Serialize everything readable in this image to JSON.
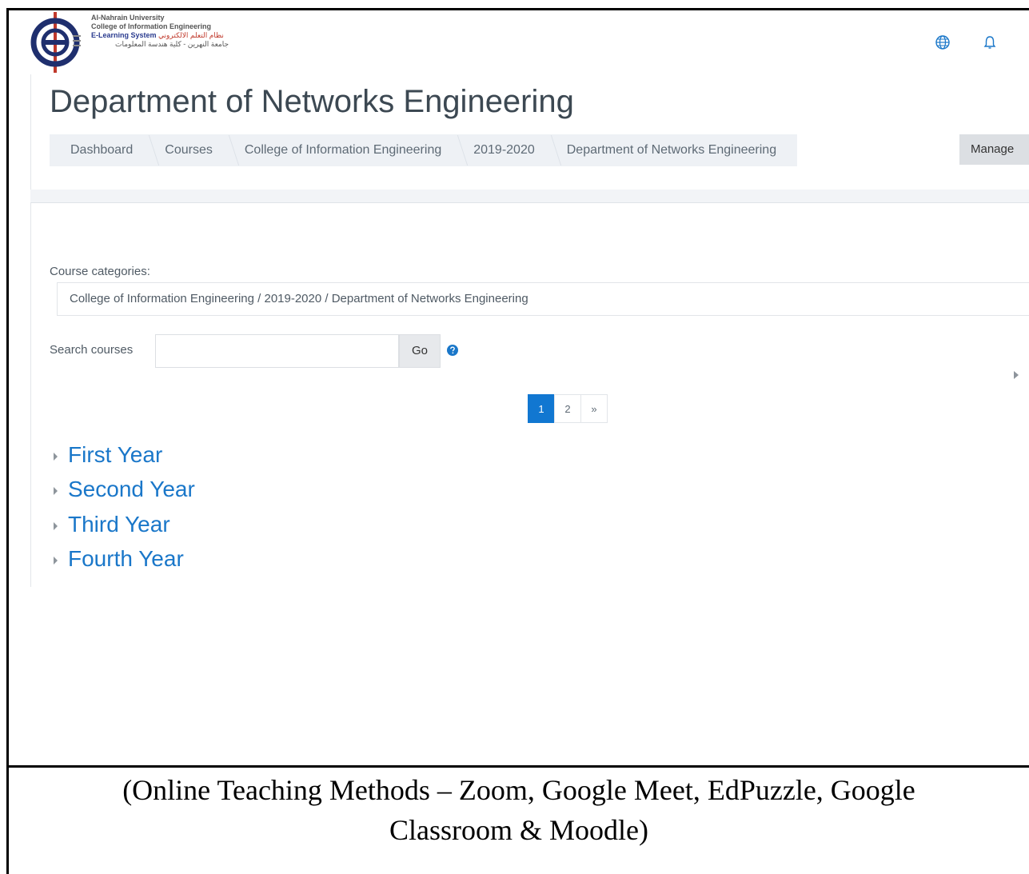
{
  "brand": {
    "university": "Al-Nahrain University",
    "college": "College of Information Engineering",
    "system": "E-Learning System",
    "system_arabic": "نظام التعلم الالكتروني",
    "subtitle_arabic": "جامعة النهرين - كلية هندسة المعلومات"
  },
  "nav": {
    "icons": [
      "globe-icon",
      "bell-icon"
    ]
  },
  "page": {
    "title": "Department of Networks Engineering"
  },
  "breadcrumb": [
    "Dashboard",
    "Courses",
    "College of Information Engineering",
    "2019-2020",
    "Department of Networks Engineering"
  ],
  "manage_button": "Manage",
  "categories": {
    "label": "Course categories:",
    "selected": "College of Information Engineering / 2019-2020 / Department of Networks Engineering"
  },
  "search": {
    "label": "Search courses",
    "value": "",
    "go": "Go"
  },
  "pagination": {
    "pages": [
      "1",
      "2",
      "»"
    ],
    "active": "1"
  },
  "years": [
    "First Year",
    "Second Year",
    "Third Year",
    "Fourth Year"
  ],
  "caption": {
    "line1": "(Online Teaching Methods – Zoom, Google Meet, EdPuzzle, Google",
    "line2": "Classroom & Moodle)"
  },
  "colors": {
    "link": "#1a77c9",
    "active_page": "#1177d1",
    "breadcrumb_bg": "#eef1f5"
  }
}
